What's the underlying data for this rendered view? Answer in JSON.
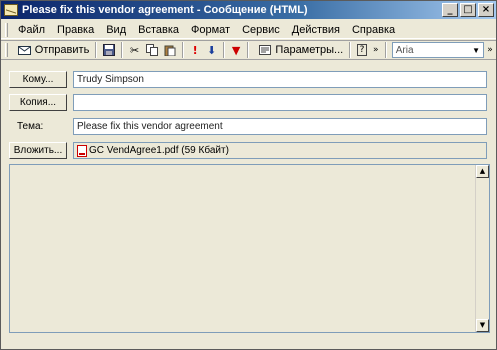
{
  "window": {
    "title": "Please fix this vendor agreement - Сообщение (HTML)",
    "controls": {
      "minimize": "_",
      "maximize": "□",
      "close": "×"
    }
  },
  "menu": [
    "Файл",
    "Правка",
    "Вид",
    "Вставка",
    "Формат",
    "Сервис",
    "Действия",
    "Справка"
  ],
  "toolbar": {
    "send_label": "Отправить",
    "params_label": "Параметры...",
    "font_value": "Aria",
    "icons": [
      "send-icon",
      "save-icon",
      "cut-icon",
      "copy-icon",
      "paste-icon",
      "importance-high-icon",
      "importance-low-icon",
      "flag-icon",
      "options-icon",
      "help-icon"
    ]
  },
  "fields": {
    "to_label": "Кому...",
    "to_value": "Trudy Simpson",
    "cc_label": "Копия...",
    "cc_value": "",
    "subject_label": "Тема:",
    "subject_value": "Please fix this vendor agreement",
    "attach_label": "Вложить...",
    "attachment": "GC VendAgree1.pdf (59 Кбайт)"
  },
  "body": {
    "text": ""
  },
  "colors": {
    "titlebar_start": "#0a246a",
    "titlebar_end": "#a6caf0",
    "window_bg": "#ece9d8"
  }
}
